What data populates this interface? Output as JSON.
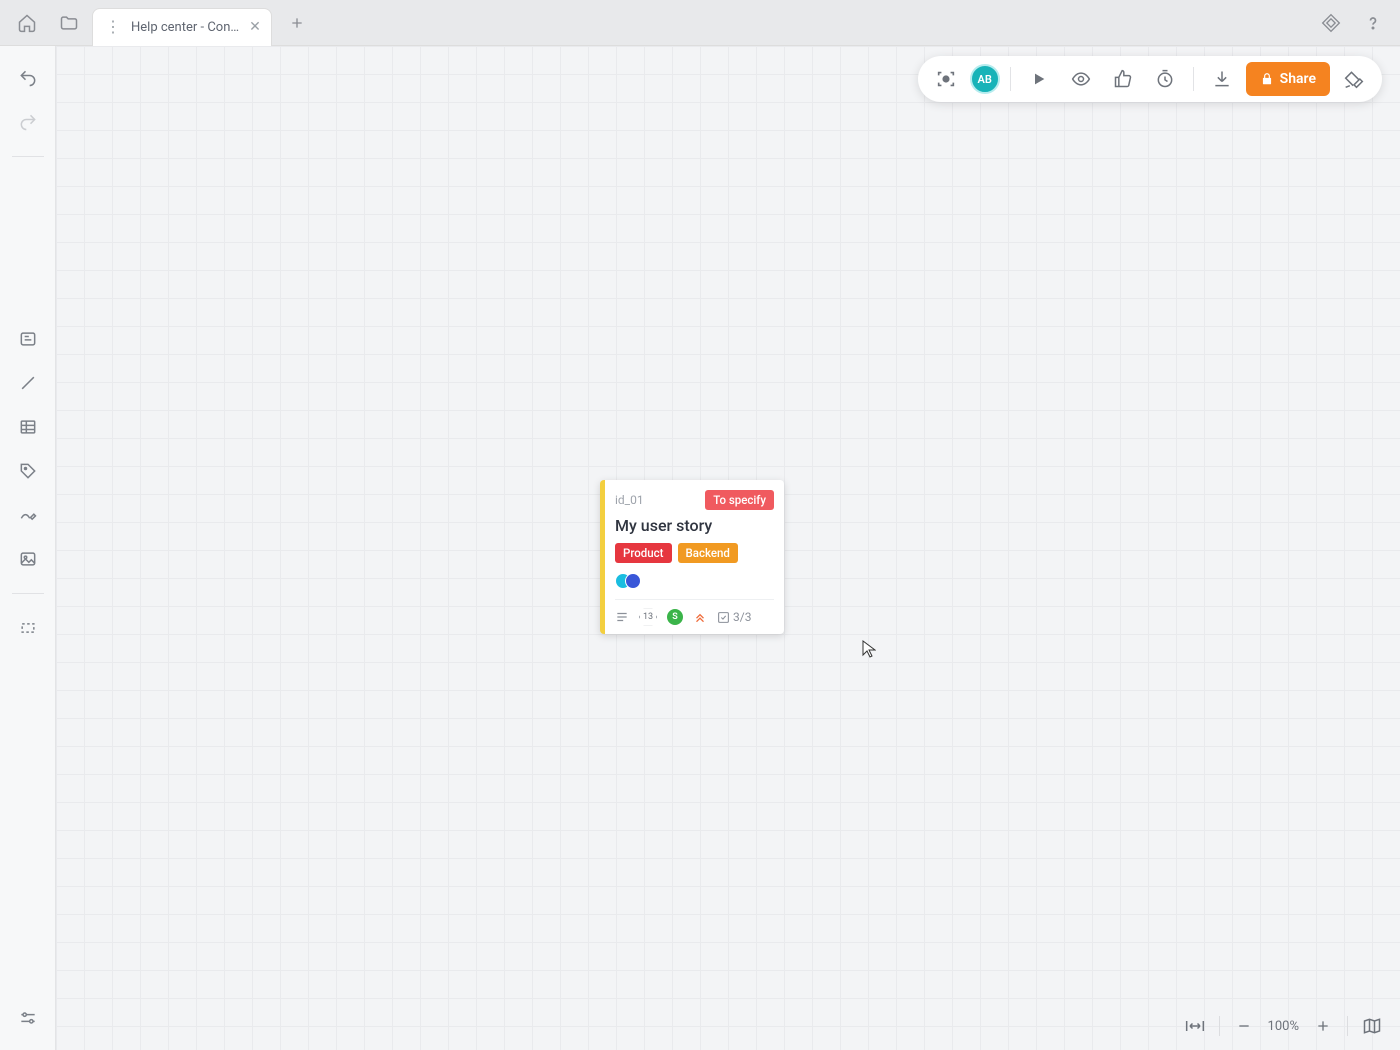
{
  "tab": {
    "title": "Help center - Con…"
  },
  "avatar": {
    "initials": "AB"
  },
  "share": {
    "label": "Share"
  },
  "card": {
    "id": "id_01",
    "status": "To specify",
    "title": "My user story",
    "tags": [
      "Product",
      "Backend"
    ],
    "estimate": "13",
    "size": "S",
    "checklist": "3/3"
  },
  "zoom": {
    "level": "100%"
  },
  "colors": {
    "accent": "#f58320",
    "card_stripe": "#f3cf3f",
    "status": "#f05a5f",
    "tag_product": "#e6373f",
    "tag_backend": "#f19a22"
  }
}
